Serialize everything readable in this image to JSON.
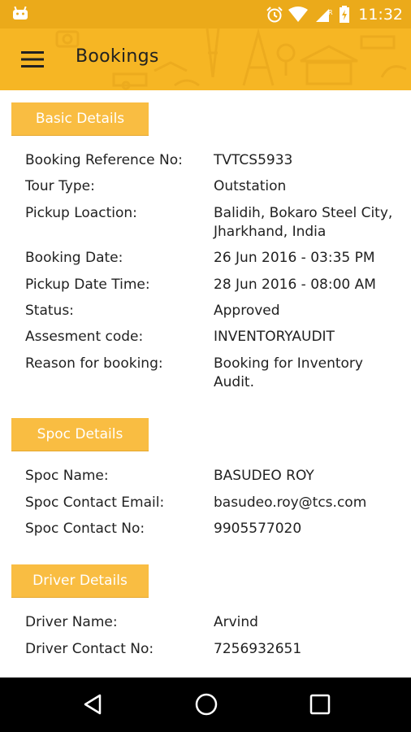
{
  "status_bar": {
    "time": "11:32",
    "icons": [
      "android-icon",
      "alarm-icon",
      "wifi-icon",
      "signal-icon",
      "battery-icon"
    ]
  },
  "app_bar": {
    "title": "Bookings",
    "menu_icon": "hamburger-menu-icon",
    "background_color": "#F6B624"
  },
  "sections": {
    "basic": {
      "title": "Basic Details",
      "rows": [
        {
          "label": "Booking Reference No:",
          "value": "TVTCS5933"
        },
        {
          "label": "Tour Type:",
          "value": "Outstation"
        },
        {
          "label": "Pickup Loaction:",
          "value": "Balidih, Bokaro Steel City, Jharkhand, India"
        },
        {
          "label": "Booking Date:",
          "value": "26 Jun 2016 - 03:35 PM"
        },
        {
          "label": "Pickup Date Time:",
          "value": "28 Jun 2016 - 08:00 AM"
        },
        {
          "label": "Status:",
          "value": "Approved"
        },
        {
          "label": "Assesment code:",
          "value": "INVENTORYAUDIT"
        },
        {
          "label": "Reason for booking:",
          "value": "Booking for Inventory Audit."
        }
      ]
    },
    "spoc": {
      "title": "Spoc Details",
      "rows": [
        {
          "label": "Spoc Name:",
          "value": "BASUDEO ROY"
        },
        {
          "label": "Spoc Contact Email:",
          "value": "basudeo.roy@tcs.com"
        },
        {
          "label": "Spoc Contact No:",
          "value": "9905577020"
        }
      ]
    },
    "driver": {
      "title": "Driver Details",
      "rows": [
        {
          "label": "Driver Name:",
          "value": "Arvind"
        },
        {
          "label": "Driver Contact No:",
          "value": "7256932651"
        }
      ]
    }
  },
  "nav_bar": {
    "icons": [
      "back-icon",
      "home-icon",
      "recents-icon"
    ]
  },
  "colors": {
    "status_bar": "#EBAA1A",
    "section_header": "#F9BD42",
    "text": "#212121"
  }
}
